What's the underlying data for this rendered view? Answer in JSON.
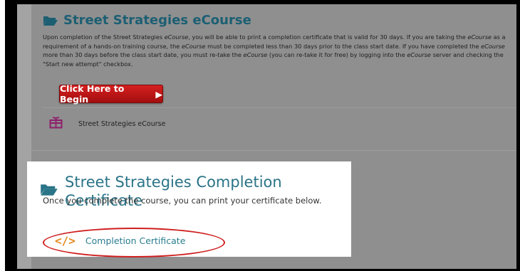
{
  "course": {
    "title": "Street Strategies eCourse",
    "description_parts": [
      "Upon completion of the Street Strategies ",
      "eCourse",
      ", you will be able to print a completion certificate that is valid for 30 days. If you are taking the ",
      "eCourse",
      " as a requirement of a hands-on training course, the ",
      "eCourse",
      " must be completed less than 30 days prior to the class start date. If you have completed the ",
      "eCourse",
      " more than 30 days before the class start date, you must re-take the ",
      "eCourse",
      " (you can re-take it for free) by logging into the ",
      "eCourse",
      " server and checking the \"Start new attempt\" checkbox."
    ],
    "begin_button_label": "Click Here to Begin",
    "begin_button_icon": "play-triangle",
    "link_label": "Street Strategies eCourse",
    "link_icon": "package-icon"
  },
  "certificate": {
    "title": "Street Strategies Completion Certificate",
    "subtitle": "Once you complete the course, you can print your certificate below.",
    "link_label": "Completion Certificate",
    "link_icon": "code-icon",
    "highlight_color": "#cf1f1f"
  },
  "colors": {
    "title_teal": "#1c5f73",
    "button_red": "#c51818",
    "icon_purple": "#8e1f6b",
    "icon_orange": "#e58a1f"
  }
}
